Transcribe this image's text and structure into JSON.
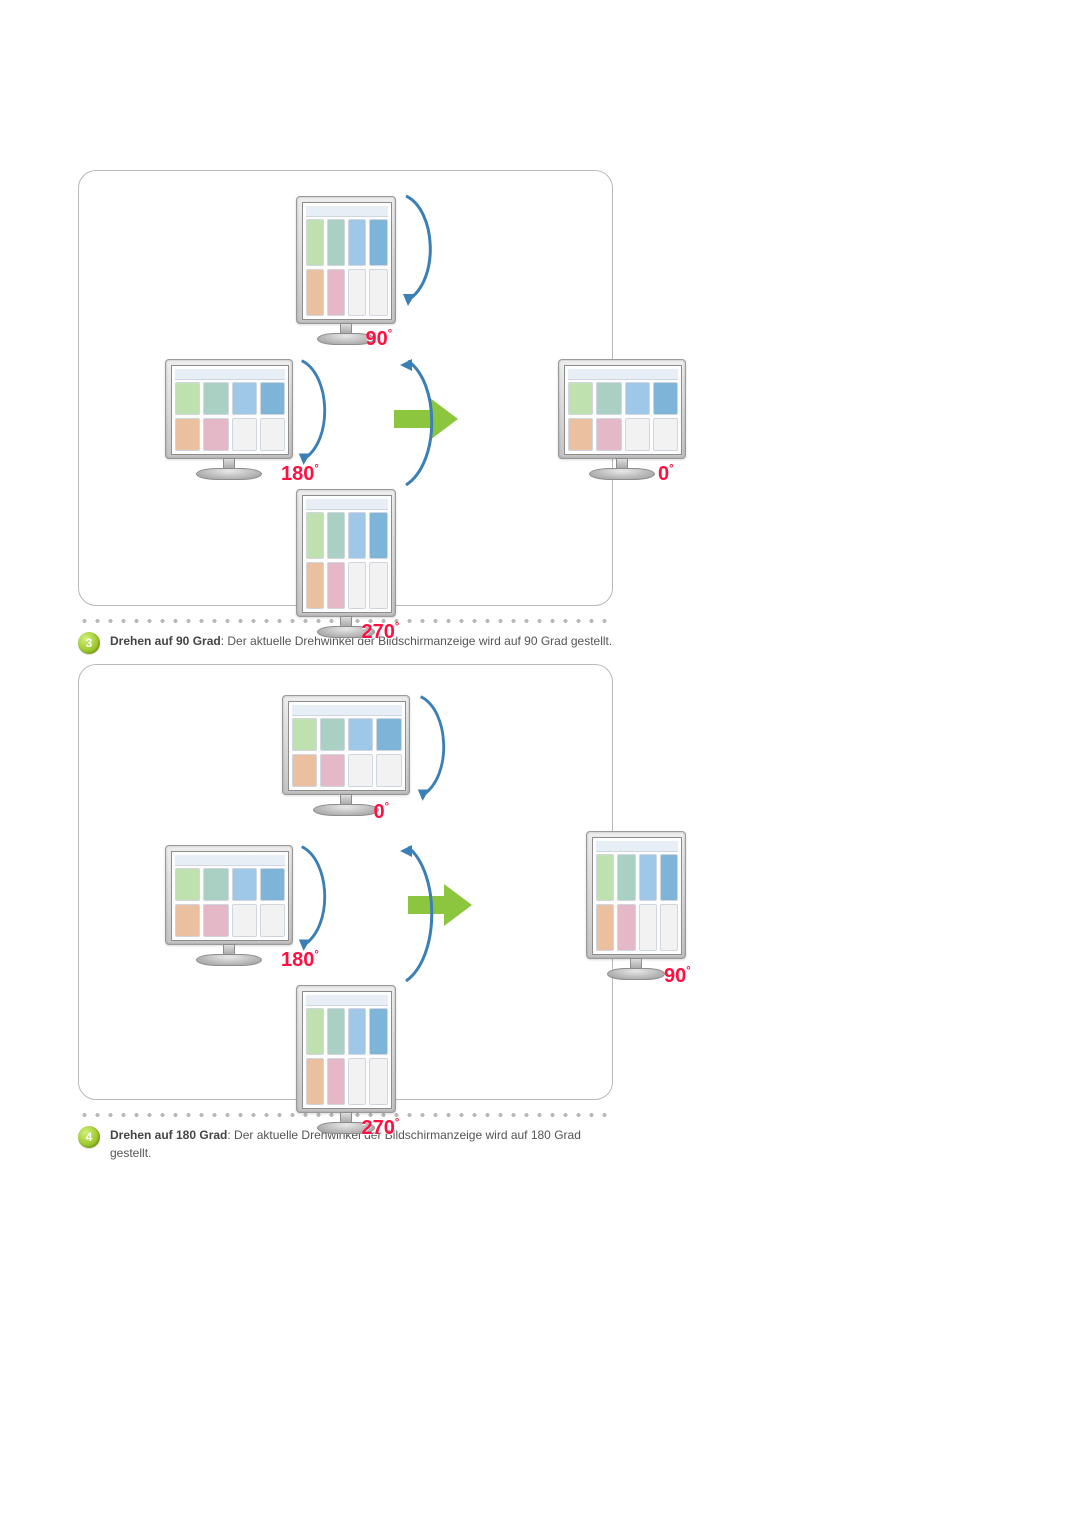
{
  "figure1": {
    "top": {
      "angle": "90",
      "orientation": "portrait"
    },
    "left": {
      "angle": "180",
      "orientation": "landscape"
    },
    "bottom": {
      "angle": "270",
      "orientation": "portrait"
    },
    "result": {
      "angle": "0",
      "orientation": "landscape"
    }
  },
  "figure2": {
    "top": {
      "angle": "0",
      "orientation": "landscape"
    },
    "left": {
      "angle": "180",
      "orientation": "landscape"
    },
    "bottom": {
      "angle": "270",
      "orientation": "portrait"
    },
    "result": {
      "angle": "90",
      "orientation": "portrait"
    }
  },
  "degree_symbol": "°",
  "items": {
    "3": {
      "title": "Drehen auf 90 Grad",
      "desc": ": Der aktuelle Drehwinkel der Bildschirmanzeige wird auf 90 Grad gestellt."
    },
    "4": {
      "title": "Drehen auf 180 Grad",
      "desc": ": Der aktuelle Drehwinkel der Bildschirmanzeige wird auf 180 Grad gestellt."
    }
  },
  "colors": {
    "accent_red": "#ff1040",
    "arrow_green": "#8cc63f",
    "curve_blue": "#3a7fb5"
  }
}
